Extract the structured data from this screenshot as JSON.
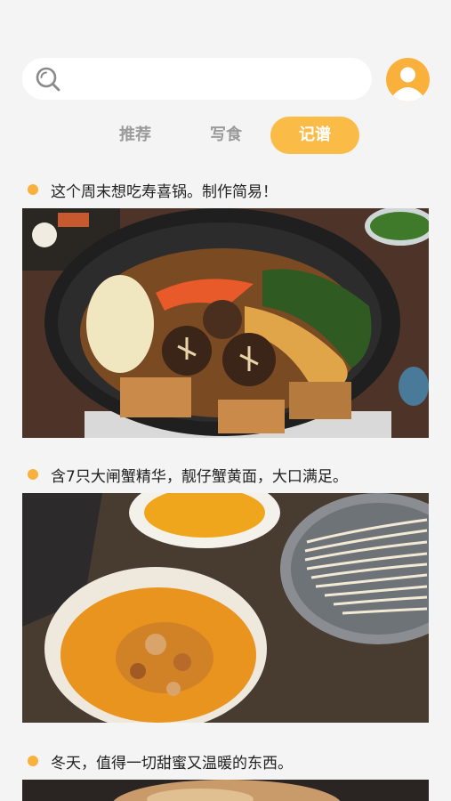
{
  "tabs": {
    "recommend": "推荐",
    "write_food": "写食",
    "recipes": "记谱"
  },
  "posts": [
    {
      "title": "这个周末想吃寿喜锅。制作简易！"
    },
    {
      "title": "含7只大闸蟹精华，靓仔蟹黄面，大口满足。"
    },
    {
      "title": "冬天，值得一切甜蜜又温暖的东西。"
    }
  ],
  "colors": {
    "accent": "#fbbc47",
    "background": "#f4f4f4"
  }
}
